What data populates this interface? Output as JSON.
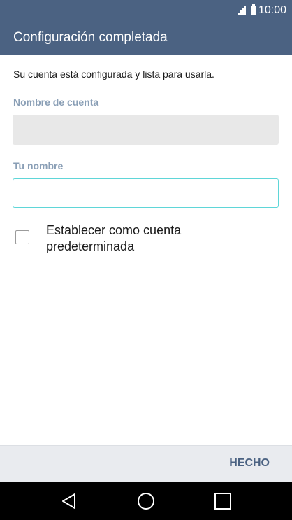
{
  "status_bar": {
    "time": "10:00"
  },
  "app_bar": {
    "title": "Configuración completada"
  },
  "main": {
    "description": "Su cuenta está configurada y lista para usarla.",
    "account_name_label": "Nombre de cuenta",
    "account_name_value": "",
    "your_name_label": "Tu nombre",
    "your_name_value": "",
    "default_account_checkbox": {
      "label": "Establecer como cuenta predeterminada",
      "checked": false
    }
  },
  "footer": {
    "done_label": "HECHO"
  },
  "nav_bar": {
    "icons": [
      "back-icon",
      "home-icon",
      "recents-icon"
    ]
  },
  "colors": {
    "header": "#4b6282",
    "field_label": "#8a9fb6",
    "focused_field_border": "#5fd6d8",
    "done_text": "#4b6282"
  }
}
